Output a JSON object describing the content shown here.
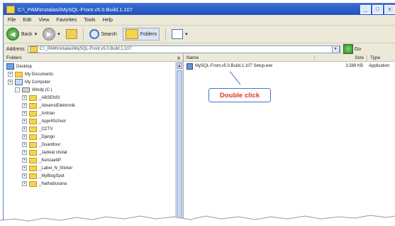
{
  "window": {
    "title": "C:\\_PAM\\Instalasi\\MySQL-Front.v5.0.Build.1.107",
    "controls": [
      "_",
      "□",
      "x"
    ]
  },
  "menu": [
    "File",
    "Edit",
    "View",
    "Favorites",
    "Tools",
    "Help"
  ],
  "toolbar": {
    "back_label": "Back",
    "search_label": "Search",
    "folders_label": "Folders"
  },
  "address": {
    "label": "Address",
    "value": "C:\\_PAM\\Instalasi\\MySQL-Front.v5.0.Build.1.107",
    "go_label": "Go"
  },
  "folders_pane": {
    "title": "Folders",
    "close": "x",
    "tree": [
      {
        "label": "Desktop",
        "icon": "desktop-icon",
        "expander": ""
      },
      {
        "label": "My Documents",
        "icon": "folder-icon",
        "expander": "+"
      },
      {
        "label": "My Computer",
        "icon": "computer-icon",
        "expander": "+"
      },
      {
        "label": "Windp (C:)",
        "icon": "drive-icon",
        "expander": "-"
      },
      {
        "label": "_ABSENSI",
        "icon": "folder-icon",
        "expander": "+"
      },
      {
        "label": "_AbsensiElektronik",
        "icon": "folder-icon",
        "expander": "+"
      },
      {
        "label": "_Antrian",
        "icon": "folder-icon",
        "expander": "+"
      },
      {
        "label": "_Appr4School",
        "icon": "folder-icon",
        "expander": "+"
      },
      {
        "label": "_CCTV",
        "icon": "folder-icon",
        "expander": "+"
      },
      {
        "label": "_Django",
        "icon": "folder-icon",
        "expander": "+"
      },
      {
        "label": "_Guardtour",
        "icon": "folder-icon",
        "expander": "+"
      },
      {
        "label": "_Jadwal sholat",
        "icon": "folder-icon",
        "expander": "+"
      },
      {
        "label": "_KenzaetIP",
        "icon": "folder-icon",
        "expander": "+"
      },
      {
        "label": "_Label_N_Sticker",
        "icon": "folder-icon",
        "expander": "+"
      },
      {
        "label": "_MyBlogSpot",
        "icon": "folder-icon",
        "expander": "+"
      },
      {
        "label": "_Nathabusana",
        "icon": "folder-icon",
        "expander": "+"
      }
    ]
  },
  "file_list": {
    "columns": {
      "name": "Name",
      "size": "Size",
      "type": "Type"
    },
    "rows": [
      {
        "name": "MySQL-Front.v5.0.Build.1.107 Setup.exe",
        "size": "3,588 KB",
        "type": "Application"
      }
    ]
  },
  "annotation": {
    "text": "Double click",
    "text_color": "#e0342e",
    "border_color": "#4a73c4"
  }
}
